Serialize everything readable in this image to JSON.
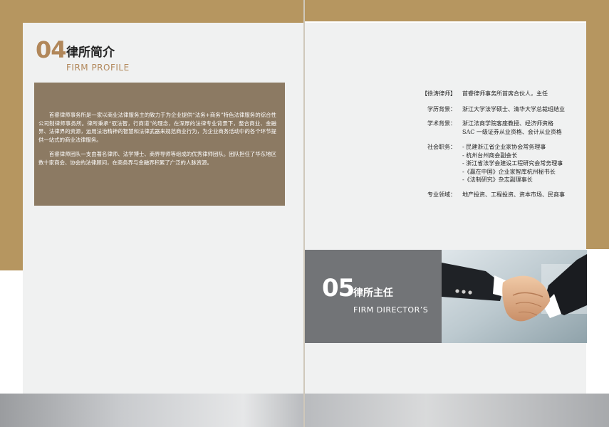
{
  "left_page": {
    "section_number": "04",
    "title_cn": "律所简介",
    "title_en": "FIRM PROFILE",
    "paragraphs": [
      "首睿律师事务所是一家以商业法律服务主的致力于为企业提供“法务+商务”特色法律服务的综合性公司制律师事务所。律所秉承“驭法智，行商道”的理念，在深厚的法律专业背景下，整合商业、金融界、法律界的资源，运用法治精神的智慧和法律武器来规范商业行为，为企业商务活动中的各个环节提供一站式的商业法律服务。",
      "首睿律师团队一支由著名律师、法学博士、商界导师等组成的优秀律师团队。团队担任了华东地区数十家商会、协会的法律顾问，在商务界与金融界积累了广泛的人脉资源。"
    ]
  },
  "right_page": {
    "info": [
      {
        "label": "【徐涛律师】",
        "lines": [
          "首睿律师事务所首席合伙人，主任"
        ]
      },
      {
        "label": "学历背景：",
        "lines": [
          "浙江大学法学硕士、清华大学总裁班结业"
        ]
      },
      {
        "label": "学术背景：",
        "lines": [
          "浙江法商学院客座教授、经济师资格",
          "SAC 一级证券从业资格、会计从业资格"
        ]
      },
      {
        "label": "社会职务：",
        "lines": [
          "- 民建浙江省企业家协会常务理事",
          "- 杭州台州商会副会长",
          "- 浙江省法学会建设工程研究会常务理事",
          "-《赢在中国》企业家智库杭州秘书长",
          "-《法制研究》杂志副理事长"
        ]
      },
      {
        "label": "专业领域：",
        "lines": [
          "地产投资、工程投资、资本市场、民商事"
        ]
      }
    ],
    "section_number": "05",
    "title_cn": "律所主任",
    "title_en": "FIRM DIRECTOR’S"
  },
  "colors": {
    "gold": "#b69660",
    "accent_text": "#b1875a",
    "profile_box": "#8c7a63",
    "director_box": "#727477",
    "page": "#f0f1f1"
  }
}
